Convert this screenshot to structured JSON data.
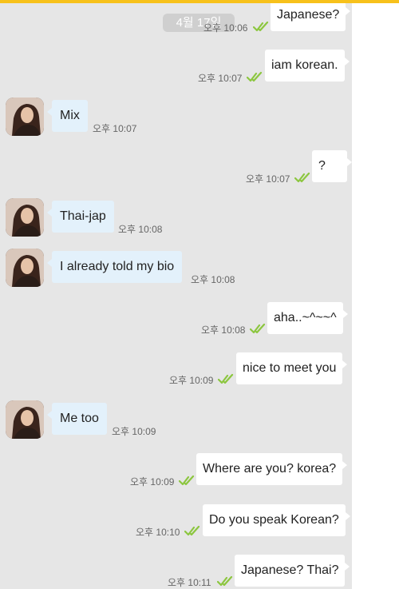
{
  "accent_color": "#f7c11b",
  "read_check_color": "#8cc63f",
  "date_pill": "4월 17일",
  "messages": [
    {
      "dir": "out",
      "text": "Japanese?",
      "time": "오후 10:06",
      "read": true
    },
    {
      "dir": "out",
      "text": "iam korean.",
      "time": "오후 10:07",
      "read": true
    },
    {
      "dir": "in",
      "text": "Mix",
      "time": "오후 10:07",
      "avatar": true
    },
    {
      "dir": "out",
      "text": "?",
      "time": "오후 10:07",
      "read": true
    },
    {
      "dir": "in",
      "text": "Thai-jap",
      "time": "오후 10:08",
      "avatar": true
    },
    {
      "dir": "in",
      "text": "I already told my bio",
      "time": "오후 10:08",
      "avatar": true
    },
    {
      "dir": "out",
      "text": "aha..~^~~^",
      "time": "오후 10:08",
      "read": true
    },
    {
      "dir": "out",
      "text": "nice to meet you",
      "time": "오후 10:09",
      "read": true
    },
    {
      "dir": "in",
      "text": "Me too",
      "time": "오후 10:09",
      "avatar": true
    },
    {
      "dir": "out",
      "text": "Where are you?  korea?",
      "time": "오후 10:09",
      "read": true
    },
    {
      "dir": "out",
      "text": "Do you speak Korean?",
      "time": "오후 10:10",
      "read": true
    },
    {
      "dir": "out",
      "text": "Japanese? Thai?",
      "time": "오후 10:11",
      "read": true
    }
  ]
}
